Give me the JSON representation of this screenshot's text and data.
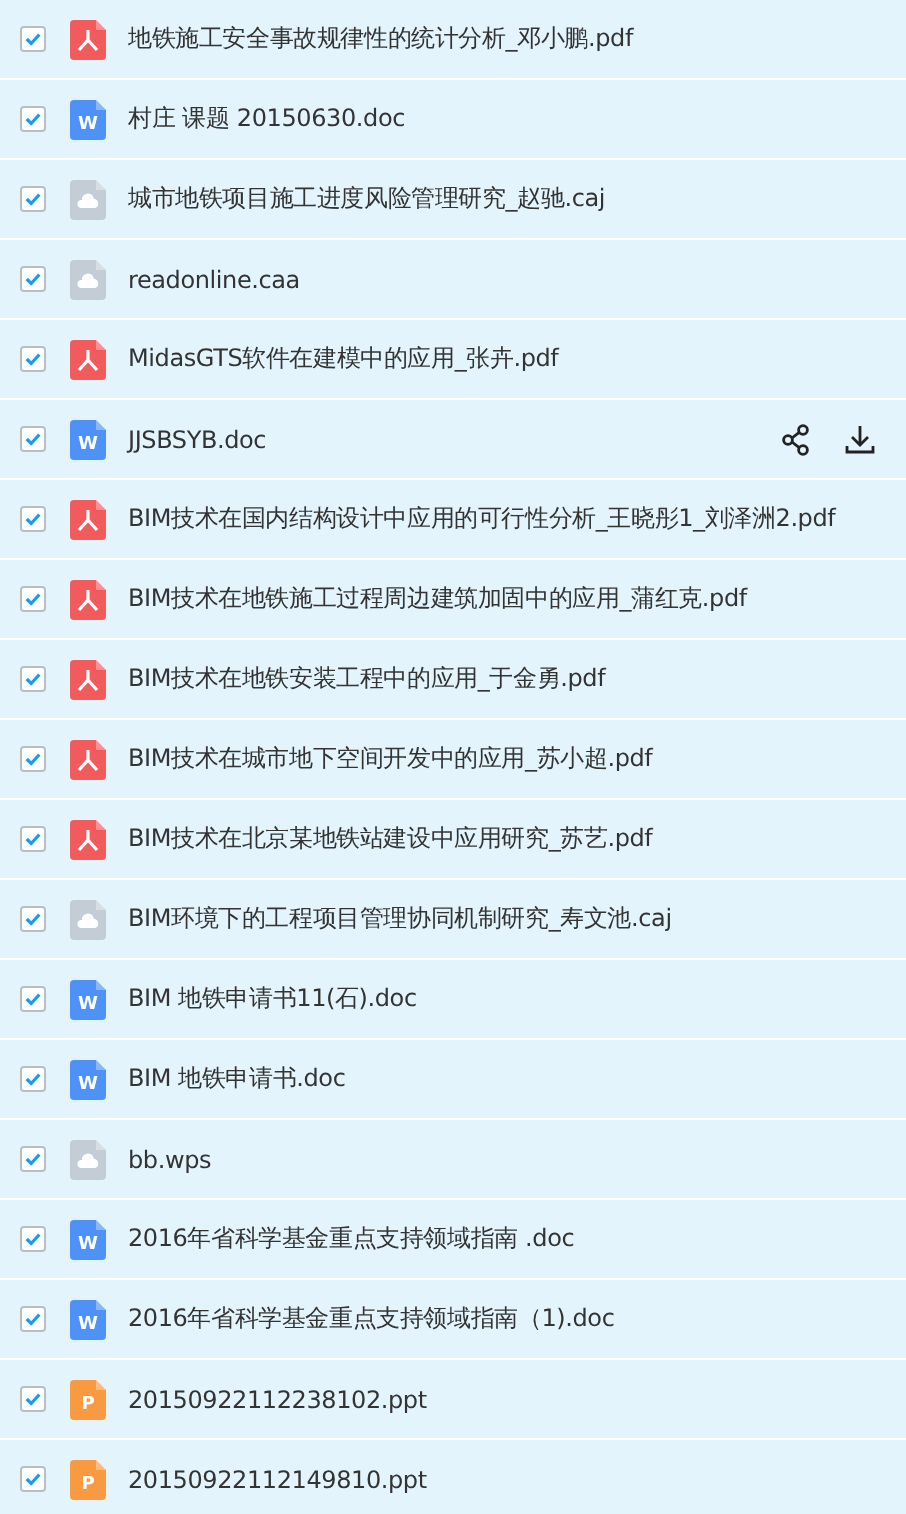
{
  "files": [
    {
      "name": "地铁施工安全事故规律性的统计分析_邓小鹏.pdf",
      "kind": "pdf",
      "checked": true,
      "hover": false
    },
    {
      "name": "村庄 课题 20150630.doc",
      "kind": "doc",
      "icon_text": "W",
      "checked": true,
      "hover": false
    },
    {
      "name": "城市地铁项目施工进度风险管理研究_赵驰.caj",
      "kind": "other",
      "checked": true,
      "hover": false
    },
    {
      "name": "readonline.caa",
      "kind": "other",
      "checked": true,
      "hover": false
    },
    {
      "name": "MidasGTS软件在建模中的应用_张卉.pdf",
      "kind": "pdf",
      "checked": true,
      "hover": false
    },
    {
      "name": "JJSBSYB.doc",
      "kind": "doc",
      "icon_text": "W",
      "checked": true,
      "hover": true
    },
    {
      "name": "BIM技术在国内结构设计中应用的可行性分析_王晓彤1_刘泽洲2.pdf",
      "kind": "pdf",
      "checked": true,
      "hover": false
    },
    {
      "name": "BIM技术在地铁施工过程周边建筑加固中的应用_蒲红克.pdf",
      "kind": "pdf",
      "checked": true,
      "hover": false
    },
    {
      "name": "BIM技术在地铁安装工程中的应用_于金勇.pdf",
      "kind": "pdf",
      "checked": true,
      "hover": false
    },
    {
      "name": "BIM技术在城市地下空间开发中的应用_苏小超.pdf",
      "kind": "pdf",
      "checked": true,
      "hover": false
    },
    {
      "name": "BIM技术在北京某地铁站建设中应用研究_苏艺.pdf",
      "kind": "pdf",
      "checked": true,
      "hover": false
    },
    {
      "name": "BIM环境下的工程项目管理协同机制研究_寿文池.caj",
      "kind": "other",
      "checked": true,
      "hover": false
    },
    {
      "name": "BIM 地铁申请书11(石).doc",
      "kind": "doc",
      "icon_text": "W",
      "checked": true,
      "hover": false
    },
    {
      "name": "BIM 地铁申请书.doc",
      "kind": "doc",
      "icon_text": "W",
      "checked": true,
      "hover": false
    },
    {
      "name": "bb.wps",
      "kind": "other",
      "checked": true,
      "hover": false
    },
    {
      "name": "2016年省科学基金重点支持领域指南 .doc",
      "kind": "doc",
      "icon_text": "W",
      "checked": true,
      "hover": false
    },
    {
      "name": "2016年省科学基金重点支持领域指南（1).doc",
      "kind": "doc",
      "icon_text": "W",
      "checked": true,
      "hover": false
    },
    {
      "name": "20150922112238102.ppt",
      "kind": "ppt",
      "icon_text": "P",
      "checked": true,
      "hover": false
    },
    {
      "name": "20150922112149810.ppt",
      "kind": "ppt",
      "icon_text": "P",
      "checked": true,
      "hover": false
    }
  ]
}
